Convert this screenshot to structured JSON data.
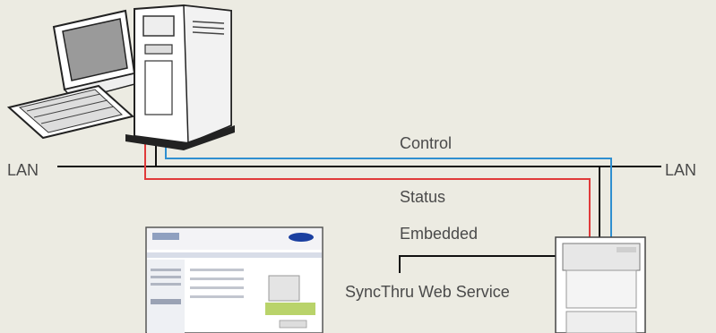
{
  "labels": {
    "lan_left": "LAN",
    "lan_right": "LAN",
    "control": "Control",
    "status": "Status",
    "embedded": "Embedded",
    "syncthru": "SyncThru Web Service"
  },
  "colors": {
    "background": "#ecebe2",
    "lan_line": "#111111",
    "control_line": "#2f8fd0",
    "status_line": "#e03a3a",
    "text": "#4a4a4a"
  },
  "icons": [
    "desktop-computer-icon",
    "printer-icon",
    "web-page-thumbnail"
  ]
}
